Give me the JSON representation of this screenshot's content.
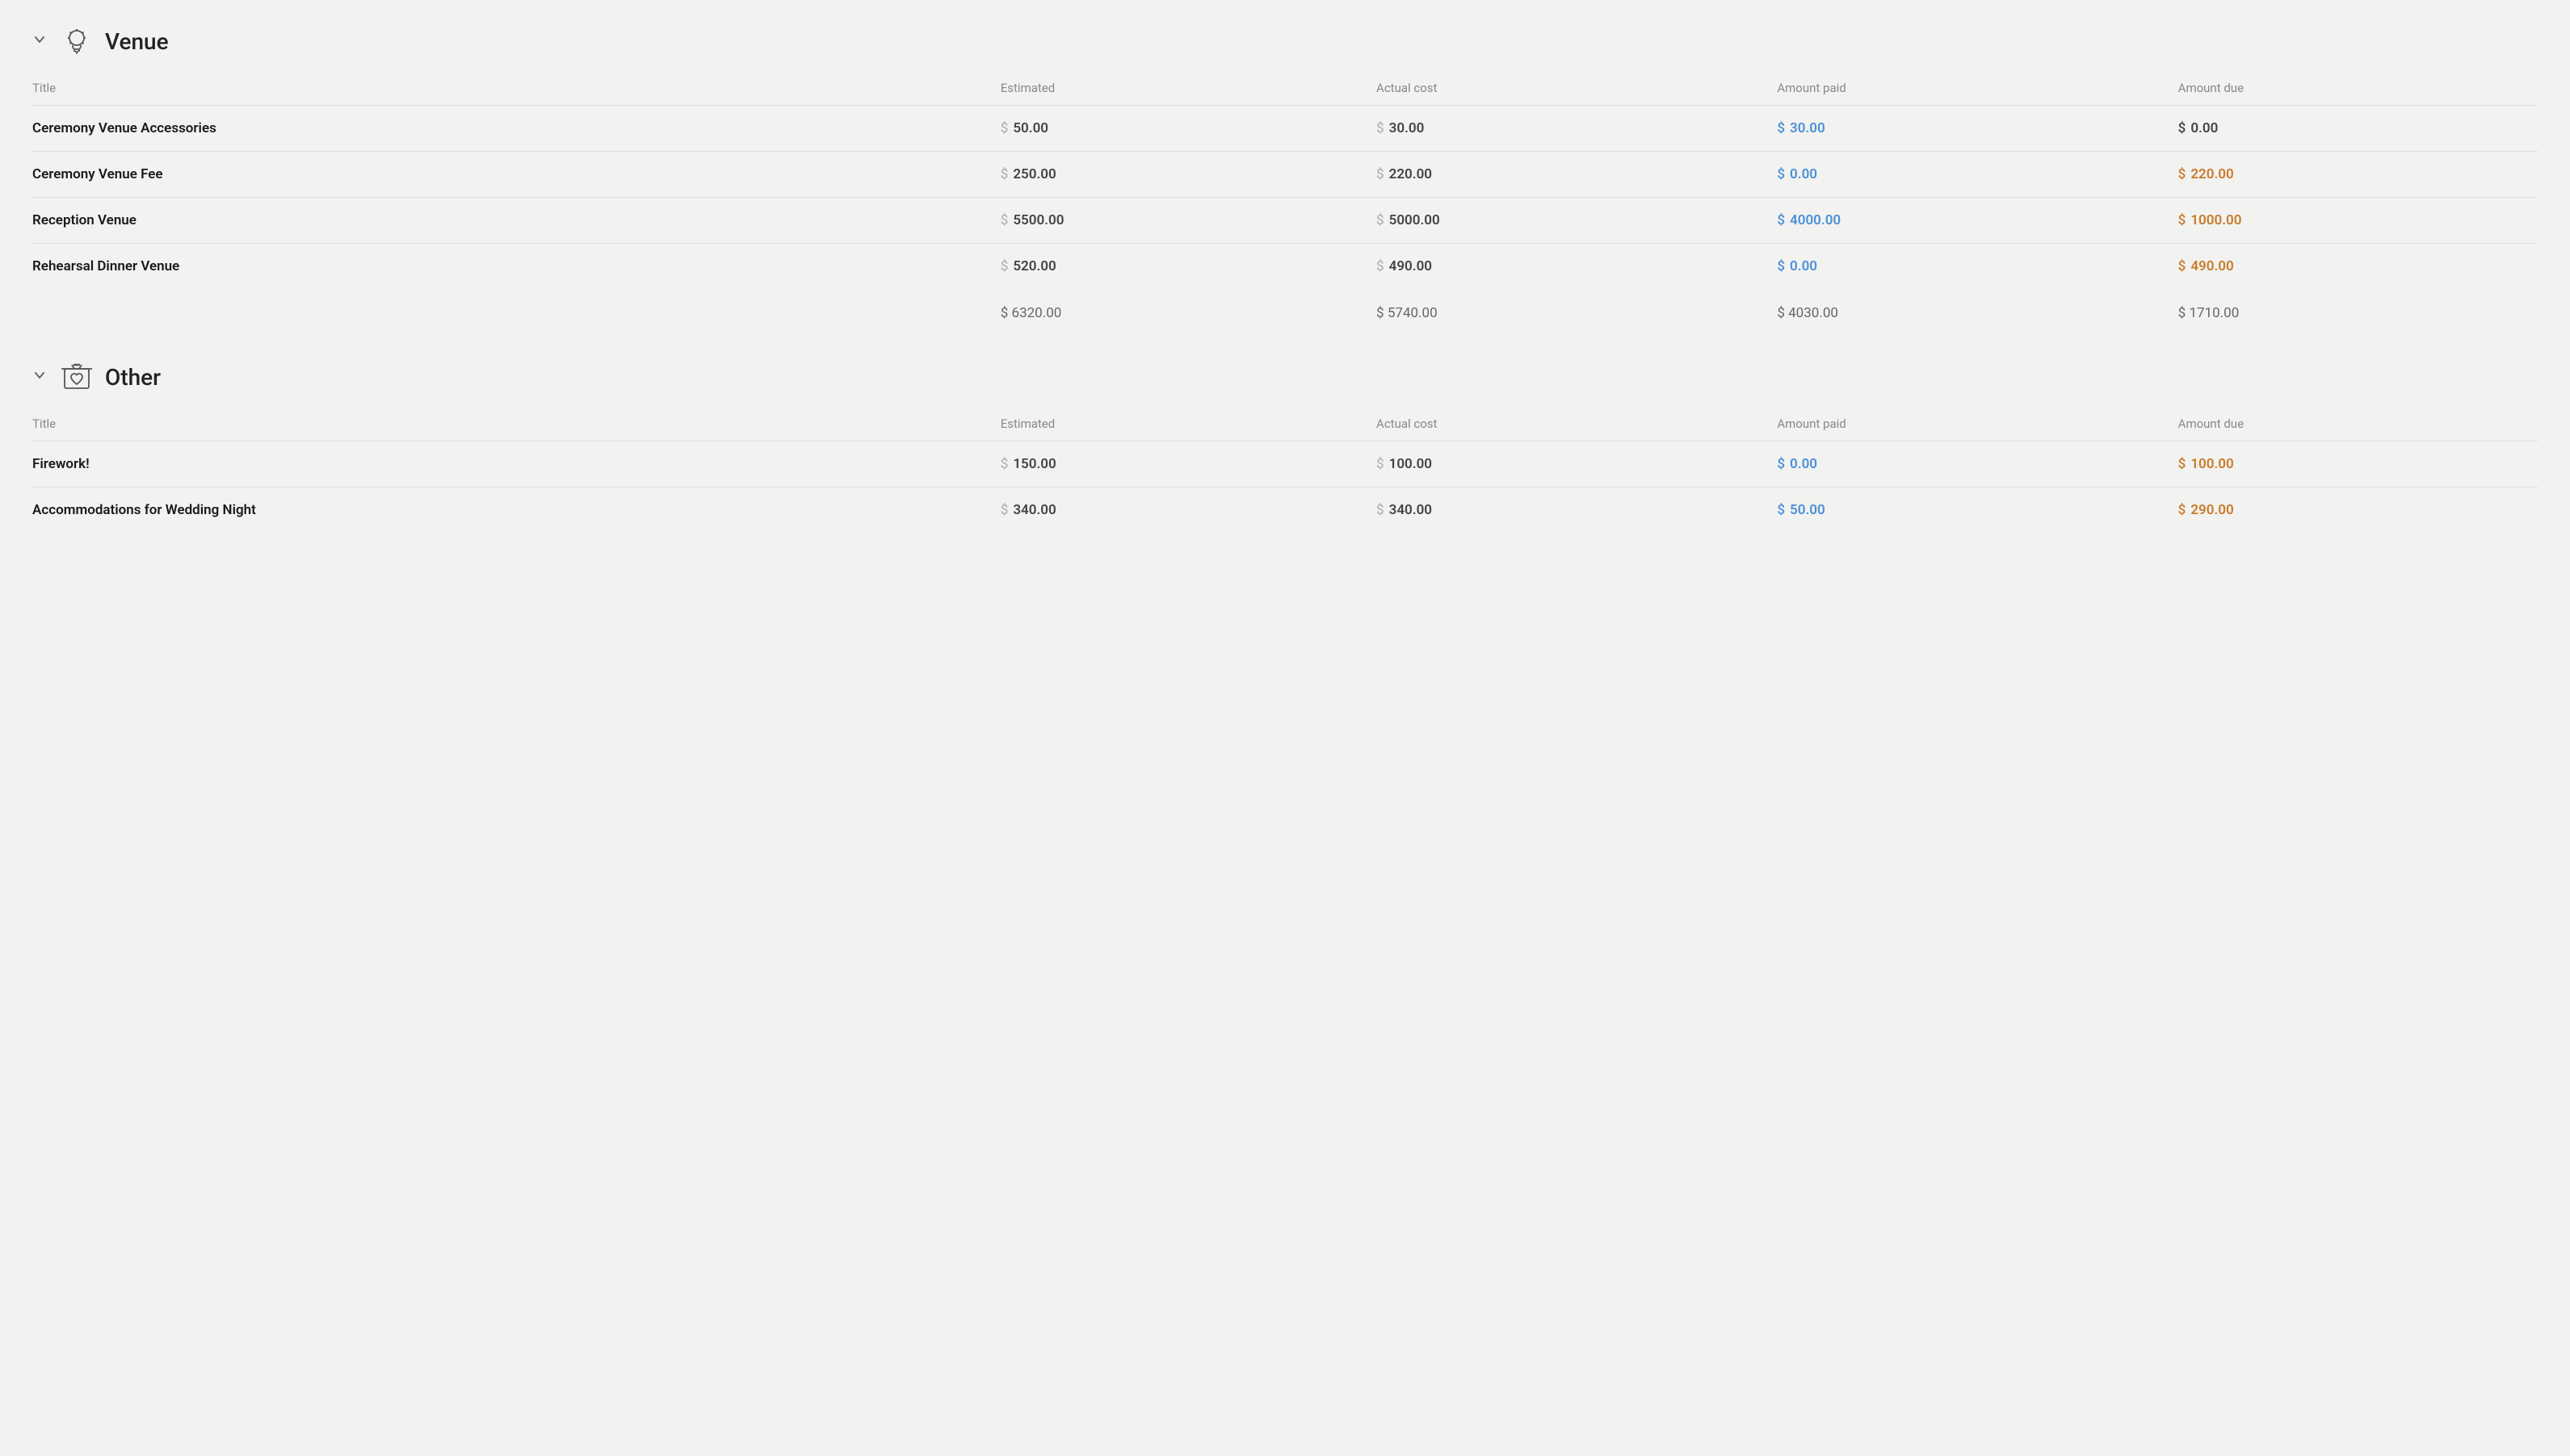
{
  "sections": [
    {
      "id": "venue",
      "title": "Venue",
      "icon_type": "lightbulb",
      "columns": {
        "title": "Title",
        "estimated": "Estimated",
        "actual_cost": "Actual cost",
        "amount_paid": "Amount paid",
        "amount_due": "Amount due"
      },
      "rows": [
        {
          "title": "Ceremony Venue Accessories",
          "estimated": "50.00",
          "actual_cost": "30.00",
          "amount_paid": "30.00",
          "amount_due": "0.00",
          "paid_color": "blue",
          "due_color": "dark"
        },
        {
          "title": "Ceremony Venue Fee",
          "estimated": "250.00",
          "actual_cost": "220.00",
          "amount_paid": "0.00",
          "amount_due": "220.00",
          "paid_color": "blue",
          "due_color": "orange"
        },
        {
          "title": "Reception Venue",
          "estimated": "5500.00",
          "actual_cost": "5000.00",
          "amount_paid": "4000.00",
          "amount_due": "1000.00",
          "paid_color": "blue",
          "due_color": "orange"
        },
        {
          "title": "Rehearsal Dinner Venue",
          "estimated": "520.00",
          "actual_cost": "490.00",
          "amount_paid": "0.00",
          "amount_due": "490.00",
          "paid_color": "blue",
          "due_color": "orange"
        }
      ],
      "totals": {
        "estimated": "$ 6320.00",
        "actual_cost": "$ 5740.00",
        "amount_paid": "$ 4030.00",
        "amount_due": "$ 1710.00"
      }
    },
    {
      "id": "other",
      "title": "Other",
      "icon_type": "heart-box",
      "columns": {
        "title": "Title",
        "estimated": "Estimated",
        "actual_cost": "Actual cost",
        "amount_paid": "Amount paid",
        "amount_due": "Amount due"
      },
      "rows": [
        {
          "title": "Firework!",
          "estimated": "150.00",
          "actual_cost": "100.00",
          "amount_paid": "0.00",
          "amount_due": "100.00",
          "paid_color": "blue",
          "due_color": "orange"
        },
        {
          "title": "Accommodations for Wedding Night",
          "estimated": "340.00",
          "actual_cost": "340.00",
          "amount_paid": "50.00",
          "amount_due": "290.00",
          "paid_color": "blue",
          "due_color": "orange"
        }
      ],
      "totals": null
    }
  ],
  "currency": "$"
}
